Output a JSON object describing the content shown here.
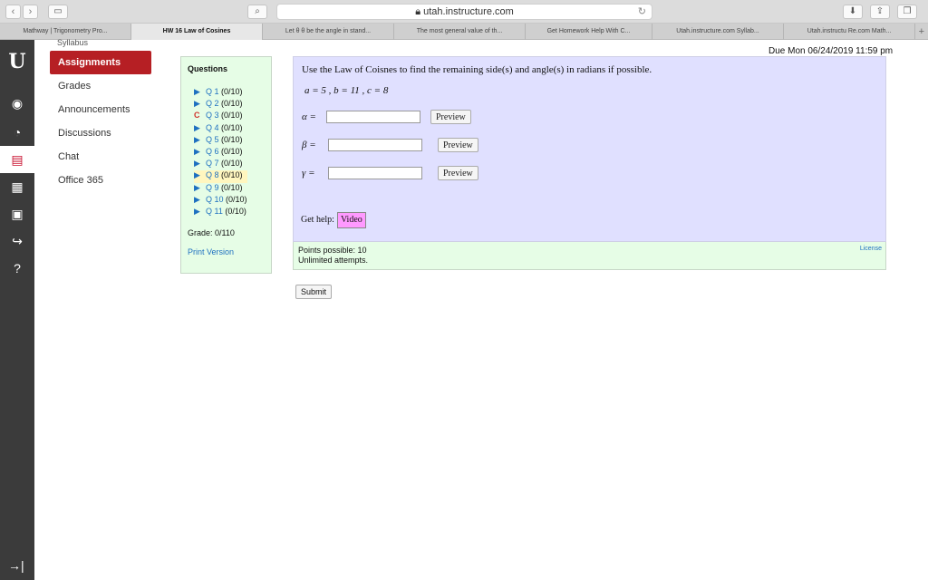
{
  "browser": {
    "url": "utah.instructure.com",
    "tabs": [
      {
        "label": "Mathway | Trigonometry Pro..."
      },
      {
        "label": "HW 16 Law of Cosines"
      },
      {
        "label": "Let θ θ be the angle in stand..."
      },
      {
        "label": "The most general value of th..."
      },
      {
        "label": "Get Homework Help With C..."
      },
      {
        "label": "Utah.instructure.com Syllab..."
      },
      {
        "label": "Utah.instructu Re.com Math..."
      }
    ]
  },
  "rail": {
    "logo": "U",
    "icons": [
      "user-icon",
      "dashboard-icon",
      "courses-icon",
      "calendar-icon",
      "inbox-icon",
      "commons-icon",
      "help-icon",
      "collapse-icon"
    ]
  },
  "course_nav": {
    "peek": "Syllabus",
    "items": [
      "Assignments",
      "Grades",
      "Announcements",
      "Discussions",
      "Chat",
      "Office 365"
    ]
  },
  "due": "Due Mon 06/24/2019 11:59 pm",
  "questions": {
    "heading": "Questions",
    "items": [
      {
        "label": "Q 1",
        "score": "(0/10)"
      },
      {
        "label": "Q 2",
        "score": "(0/10)"
      },
      {
        "label": "Q 3",
        "score": "(0/10)"
      },
      {
        "label": "Q 4",
        "score": "(0/10)"
      },
      {
        "label": "Q 5",
        "score": "(0/10)"
      },
      {
        "label": "Q 6",
        "score": "(0/10)"
      },
      {
        "label": "Q 7",
        "score": "(0/10)"
      },
      {
        "label": "Q 8",
        "score": "(0/10)"
      },
      {
        "label": "Q 9",
        "score": "(0/10)"
      },
      {
        "label": "Q 10",
        "score": "(0/10)"
      },
      {
        "label": "Q 11",
        "score": "(0/10)"
      }
    ],
    "grade": "Grade: 0/110",
    "print": "Print Version"
  },
  "problem": {
    "prompt": "Use the Law of Coisnes to find the remaining side(s) and angle(s) in radians if possible.",
    "given": "a = 5 , b = 11 , c = 8",
    "answers": [
      {
        "label": "α =",
        "value": "",
        "preview": "Preview"
      },
      {
        "label": "β =",
        "value": "",
        "preview": "Preview"
      },
      {
        "label": "γ =",
        "value": "",
        "preview": "Preview"
      }
    ],
    "help_label": "Get help:",
    "video": "Video"
  },
  "points": {
    "possible": "Points possible: 10",
    "attempts": "Unlimited attempts.",
    "license": "License"
  },
  "submit": "Submit"
}
